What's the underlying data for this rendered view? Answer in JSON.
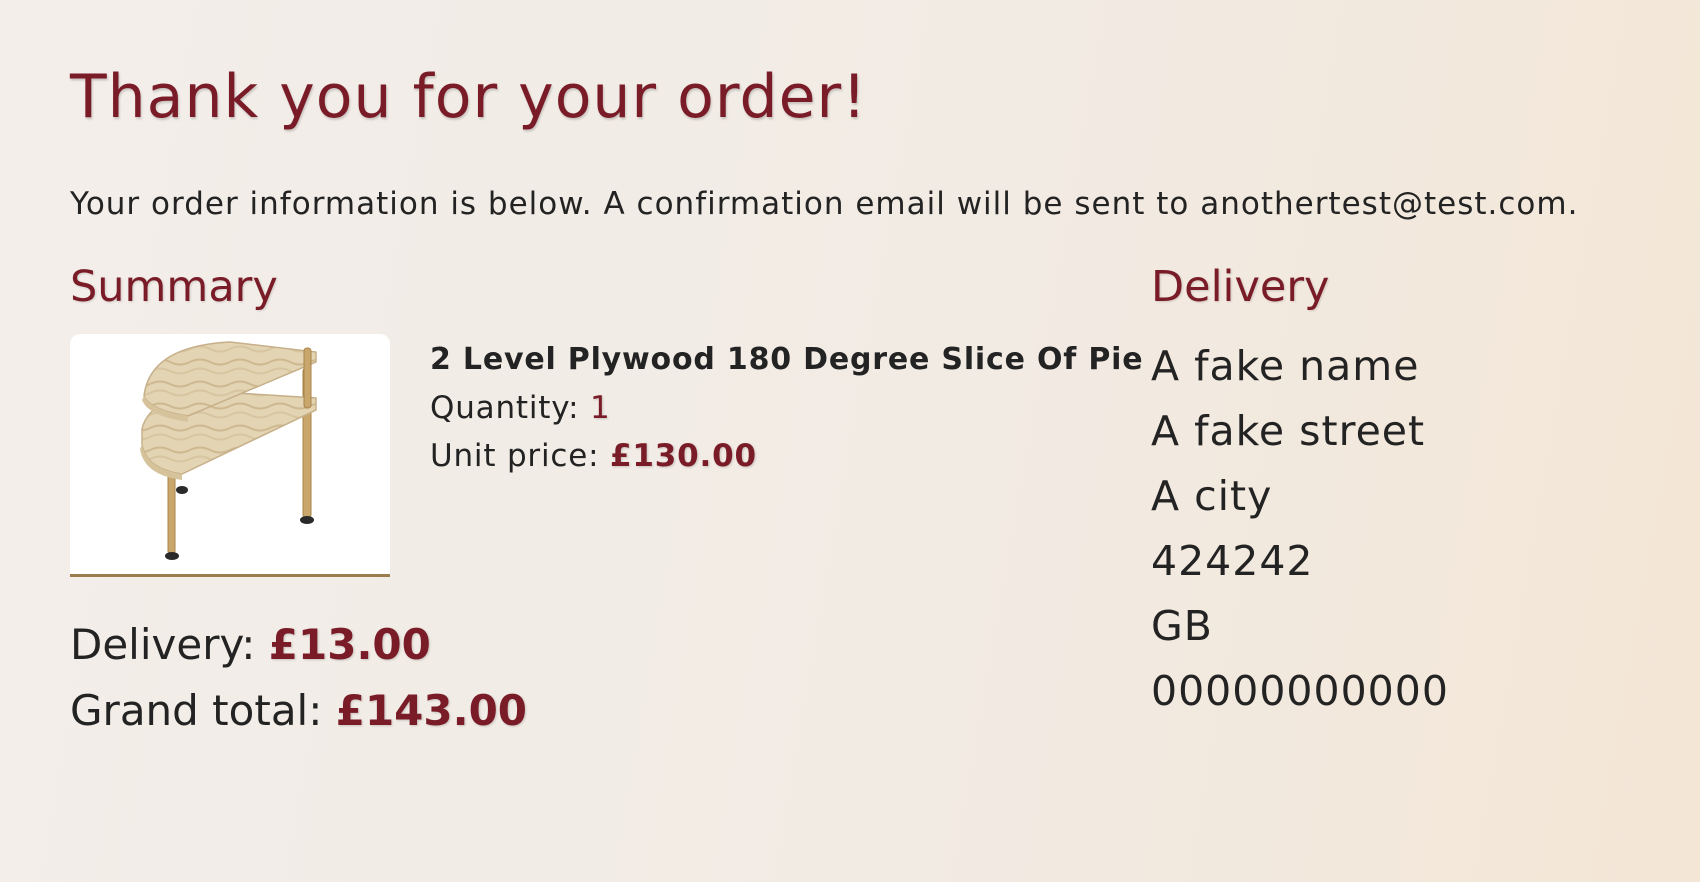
{
  "page": {
    "title": "Thank you for your order!",
    "intro": "Your order information is below. A confirmation email will be sent to anothertest@test.com."
  },
  "summary": {
    "heading": "Summary",
    "item": {
      "image_alt": "2 Level Plywood 180 Degree Slice Of Pie",
      "name": "2 Level Plywood 180 Degree Slice Of Pie",
      "quantity_label": "Quantity:",
      "quantity": "1",
      "unit_price_label": "Unit price:",
      "unit_price": "£130.00"
    },
    "delivery_label": "Delivery:",
    "delivery_cost": "£13.00",
    "grand_total_label": "Grand total:",
    "grand_total": "£143.00"
  },
  "delivery": {
    "heading": "Delivery",
    "name": "A fake name",
    "street": "A fake street",
    "city": "A city",
    "postcode": "424242",
    "country": "GB",
    "phone": "00000000000"
  },
  "colors": {
    "accent": "#7a1c28",
    "text": "#232323",
    "image_border": "#9b7d4e"
  }
}
